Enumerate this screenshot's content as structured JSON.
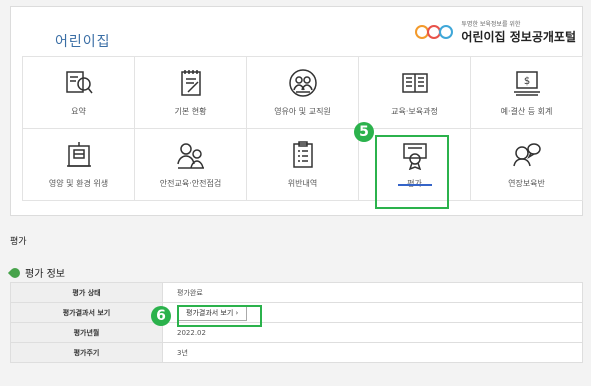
{
  "header": {
    "brand": "어린이집",
    "logo_sub": "투명한 보육정보를 위한",
    "logo_main": "어린이집 정보공개포털"
  },
  "menu": [
    {
      "label": "요약",
      "icon": "search-document-icon"
    },
    {
      "label": "기본 현황",
      "icon": "notepad-icon"
    },
    {
      "label": "영유아 및 교직원",
      "icon": "people-icon"
    },
    {
      "label": "교육·보육과정",
      "icon": "book-icon"
    },
    {
      "label": "예·결산 등 회계",
      "icon": "money-icon"
    },
    {
      "label": "영양 및 환경 위생",
      "icon": "building-icon"
    },
    {
      "label": "안전교육·안전점검",
      "icon": "people-check-icon"
    },
    {
      "label": "위반내역",
      "icon": "checklist-icon"
    },
    {
      "label": "평가",
      "icon": "certificate-icon",
      "active": true
    },
    {
      "label": "연장보육반",
      "icon": "person-chat-icon"
    }
  ],
  "steps": {
    "five": "5",
    "six": "6"
  },
  "section_title": "평가",
  "info_title": "평가 정보",
  "table": [
    {
      "label": "평가 상태",
      "value": "평가완료"
    },
    {
      "label": "평가결과서 보기",
      "value": "평가결과서 보기 ›"
    },
    {
      "label": "평가년월",
      "value": "2022.02"
    },
    {
      "label": "평가주기",
      "value": "3년"
    }
  ],
  "colors": {
    "highlight": "#2bb24c",
    "accent": "#3564c8"
  }
}
